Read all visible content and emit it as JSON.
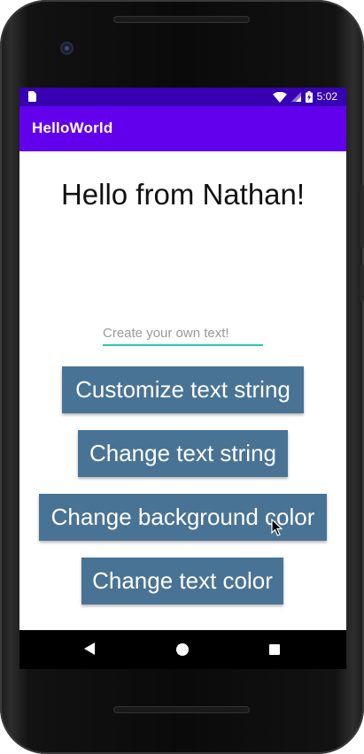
{
  "status_bar": {
    "time": "5:02",
    "icons": [
      "sim-card-icon",
      "wifi-icon",
      "cellular-signal-icon",
      "battery-charging-icon"
    ]
  },
  "app_bar": {
    "title": "HelloWorld"
  },
  "main": {
    "hello_text": "Hello from Nathan!",
    "input": {
      "placeholder": "Create your own text!",
      "value": ""
    },
    "buttons": [
      {
        "label": "Customize text string"
      },
      {
        "label": "Change text string"
      },
      {
        "label": "Change background color"
      },
      {
        "label": "Change text color"
      }
    ]
  },
  "nav_bar": {
    "icons": [
      "back-icon",
      "home-icon",
      "recents-icon"
    ]
  },
  "colors": {
    "status_bar": "#3700b3",
    "app_bar": "#6200ee",
    "button": "#497394",
    "input_underline": "#26c6b6"
  }
}
